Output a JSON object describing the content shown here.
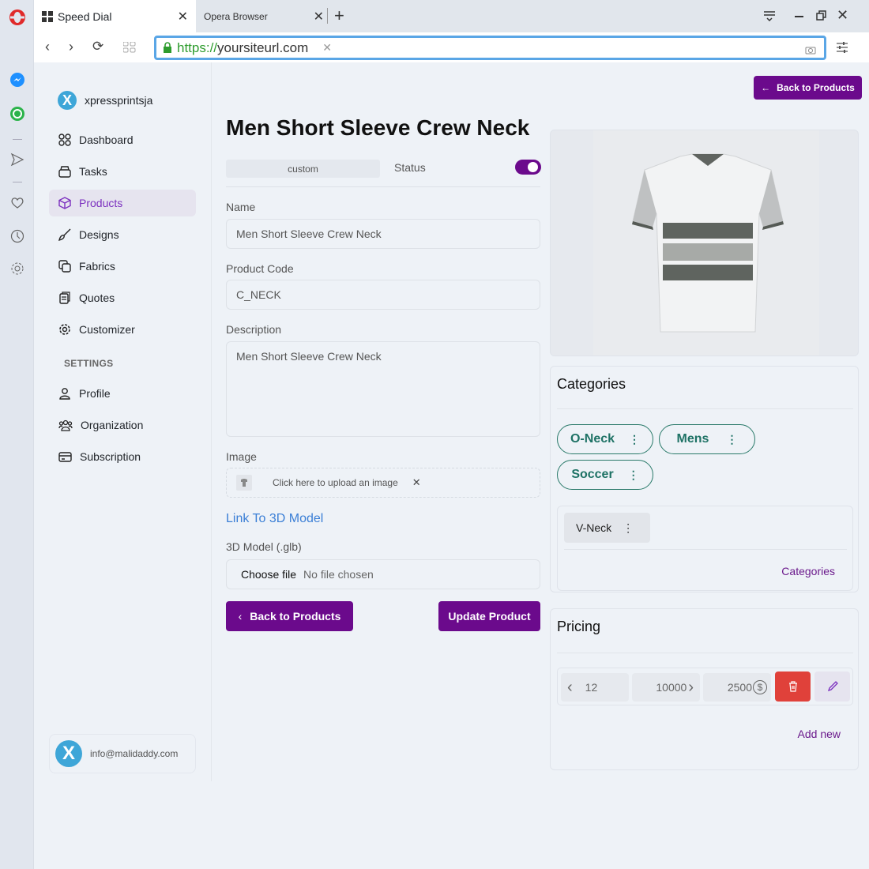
{
  "browser": {
    "tabs": [
      {
        "label": "Speed Dial",
        "icon": "speed-dial-grid-icon",
        "active": true
      },
      {
        "label": "Opera Browser",
        "active": false
      }
    ],
    "url_scheme": "https://",
    "url_host": "yoursiteurl.com",
    "rail_icons": [
      "opera-logo-icon",
      "messenger-icon",
      "whatsapp-icon",
      "send-icon",
      "heart-icon",
      "history-icon",
      "settings-icon"
    ]
  },
  "sidebar": {
    "brand": "xpressprintsja",
    "items": [
      {
        "label": "Dashboard",
        "icon": "grid-icon"
      },
      {
        "label": "Tasks",
        "icon": "tray-icon"
      },
      {
        "label": "Products",
        "icon": "cube-icon",
        "active": true
      },
      {
        "label": "Designs",
        "icon": "brush-icon"
      },
      {
        "label": "Fabrics",
        "icon": "copy-icon"
      },
      {
        "label": "Quotes",
        "icon": "clipboard-icon"
      },
      {
        "label": "Customizer",
        "icon": "gear-icon"
      }
    ],
    "settings_heading": "SETTINGS",
    "settings_items": [
      {
        "label": "Profile",
        "icon": "user-icon"
      },
      {
        "label": "Organization",
        "icon": "users-icon"
      },
      {
        "label": "Subscription",
        "icon": "card-icon"
      }
    ],
    "user_email": "info@malidaddy.com"
  },
  "form": {
    "title": "Men Short Sleeve Crew Neck",
    "type_pill": "custom",
    "status_label": "Status",
    "status_on": true,
    "name_label": "Name",
    "name_value": "Men Short Sleeve Crew Neck",
    "code_label": "Product Code",
    "code_value": "C_NECK",
    "desc_label": "Description",
    "desc_value": "Men Short Sleeve Crew Neck",
    "image_label": "Image",
    "upload_text": "Click here to upload an image",
    "link_3d": "Link To 3D Model",
    "model_label": "3D Model (.glb)",
    "choose_file": "Choose file",
    "no_file": "No file chosen",
    "back_label": "Back to Products",
    "update_label": "Update Product"
  },
  "top_back_label": "Back to Products",
  "categories": {
    "heading": "Categories",
    "selected": [
      "O-Neck",
      "Mens",
      "Soccer"
    ],
    "available": [
      "V-Neck"
    ],
    "link": "Categories"
  },
  "pricing": {
    "heading": "Pricing",
    "rows": [
      {
        "min_qty": "12",
        "max_qty": "10000",
        "price": "2500"
      }
    ],
    "add_new": "Add new"
  },
  "colors": {
    "accent": "#6b0a8c",
    "chip": "#1e7265",
    "danger": "#e0413a",
    "link": "#3b7fd6"
  }
}
